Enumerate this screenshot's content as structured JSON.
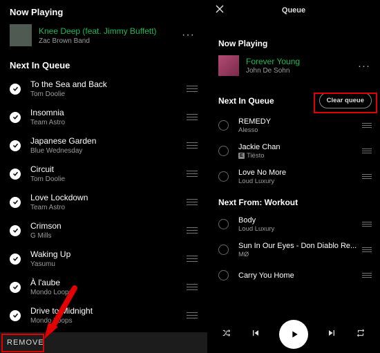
{
  "left": {
    "now_playing_header": "Now Playing",
    "track": {
      "title": "Knee Deep (feat. Jimmy Buffett)",
      "artist": "Zac Brown Band"
    },
    "queue_header": "Next In Queue",
    "rows": [
      {
        "title": "To the Sea and Back",
        "artist": "Tom Doolie"
      },
      {
        "title": "Insomnia",
        "artist": "Team Astro"
      },
      {
        "title": "Japanese Garden",
        "artist": "Blue Wednesday"
      },
      {
        "title": "Circuit",
        "artist": "Tom Doolie"
      },
      {
        "title": "Love Lockdown",
        "artist": "Team Astro"
      },
      {
        "title": "Crimson",
        "artist": "G Mills"
      },
      {
        "title": "Waking Up",
        "artist": "Yasumu"
      },
      {
        "title": "À l'aube",
        "artist": "Mondo Loops"
      },
      {
        "title": "Drive to Midnight",
        "artist": "Mondo Loops"
      }
    ],
    "remove_label": "REMOVE"
  },
  "right": {
    "header_title": "Queue",
    "now_playing_header": "Now Playing",
    "track": {
      "title": "Forever Young",
      "artist": "John De Sohn"
    },
    "queue_header": "Next In Queue",
    "clear_label": "Clear queue",
    "queue_rows": [
      {
        "title": "REMEDY",
        "artist": "Alesso",
        "explicit": false
      },
      {
        "title": "Jackie Chan",
        "artist": "Tiësto",
        "explicit": true
      },
      {
        "title": "Love No More",
        "artist": "Loud Luxury",
        "explicit": false
      }
    ],
    "next_from_header": "Next From: Workout",
    "next_from_rows": [
      {
        "title": "Body",
        "artist": "Loud Luxury"
      },
      {
        "title": "Sun In Our Eyes - Don Diablo Re...",
        "artist": "MØ"
      },
      {
        "title": "Carry You Home",
        "artist": ""
      }
    ]
  }
}
